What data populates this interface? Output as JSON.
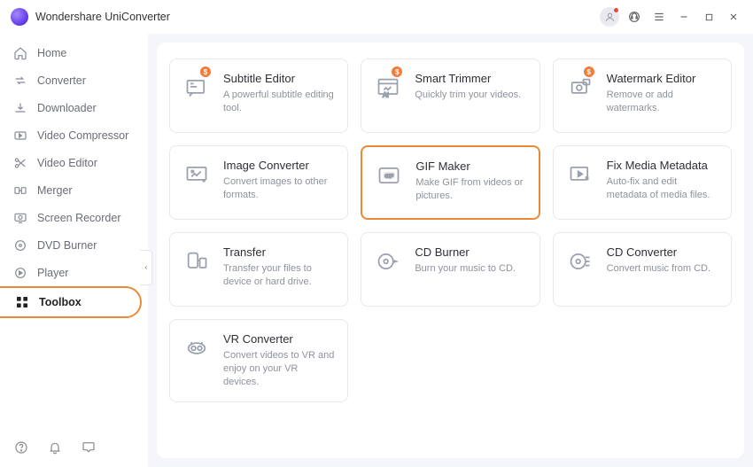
{
  "app": {
    "title": "Wondershare UniConverter"
  },
  "sidebar": {
    "items": [
      {
        "label": "Home"
      },
      {
        "label": "Converter"
      },
      {
        "label": "Downloader"
      },
      {
        "label": "Video Compressor"
      },
      {
        "label": "Video Editor"
      },
      {
        "label": "Merger"
      },
      {
        "label": "Screen Recorder"
      },
      {
        "label": "DVD Burner"
      },
      {
        "label": "Player"
      },
      {
        "label": "Toolbox"
      }
    ]
  },
  "tools": [
    {
      "title": "Subtitle Editor",
      "desc": "A powerful subtitle editing tool.",
      "badge": "$"
    },
    {
      "title": "Smart Trimmer",
      "desc": "Quickly trim your videos.",
      "badge": "$"
    },
    {
      "title": "Watermark Editor",
      "desc": "Remove or add watermarks.",
      "badge": "$"
    },
    {
      "title": "Image Converter",
      "desc": "Convert images to other formats."
    },
    {
      "title": "GIF Maker",
      "desc": "Make GIF from videos or pictures."
    },
    {
      "title": "Fix Media Metadata",
      "desc": "Auto-fix and edit metadata of media files."
    },
    {
      "title": "Transfer",
      "desc": "Transfer your files to device or hard drive."
    },
    {
      "title": "CD Burner",
      "desc": "Burn your music to CD."
    },
    {
      "title": "CD Converter",
      "desc": "Convert music from CD."
    },
    {
      "title": "VR Converter",
      "desc": "Convert videos to VR and enjoy on your VR devices."
    }
  ],
  "highlight_index": 4
}
